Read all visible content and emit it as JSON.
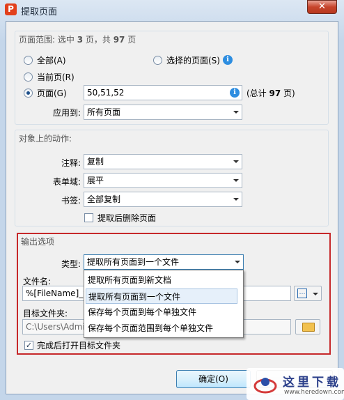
{
  "window": {
    "title": "提取页面",
    "app_icon": "P"
  },
  "page_range": {
    "title_prefix": "页面范围: 选中 ",
    "selected": "3",
    "title_mid": " 页，共 ",
    "total": "97",
    "title_suffix": " 页",
    "all_label": "全部(A)",
    "selected_pages_label": "选择的页面(S)",
    "current_label": "当前页(R)",
    "pages_label": "页面(G)",
    "pages_value": "50,51,52",
    "total_note_prefix": "(总计 ",
    "total_note_value": "97",
    "total_note_suffix": " 页)",
    "apply_to_label": "应用到:",
    "apply_to_value": "所有页面",
    "selected_option": "pages"
  },
  "actions": {
    "title": "对象上的动作:",
    "annotations_label": "注释:",
    "annotations_value": "复制",
    "forms_label": "表单域:",
    "forms_value": "展平",
    "bookmarks_label": "书签:",
    "bookmarks_value": "全部复制",
    "delete_after_label": "提取后删除页面",
    "delete_after_checked": false
  },
  "output": {
    "title": "输出选项",
    "type_label": "类型:",
    "type_value": "提取所有页面到一个文件",
    "type_options": [
      "提取所有页面到新文档",
      "提取所有页面到一个文件",
      "保存每个页面到每个单独文件",
      "保存每个页面范围到每个单独文件"
    ],
    "highlighted_option_index": 1,
    "filename_label": "文件名:",
    "filename_value": "%[FileName]_%",
    "folder_label": "目标文件夹:",
    "folder_value": "C:\\Users\\Admi",
    "open_folder_label": "完成后打开目标文件夹",
    "open_folder_checked": true
  },
  "buttons": {
    "ok_label": "确定(O)"
  },
  "watermark": {
    "text": "这里下载",
    "url": "www.heredown.com"
  },
  "colors": {
    "highlight_border": "#c6282a",
    "info_blue": "#2d8de0",
    "title_bar": "#c4d6ea"
  }
}
